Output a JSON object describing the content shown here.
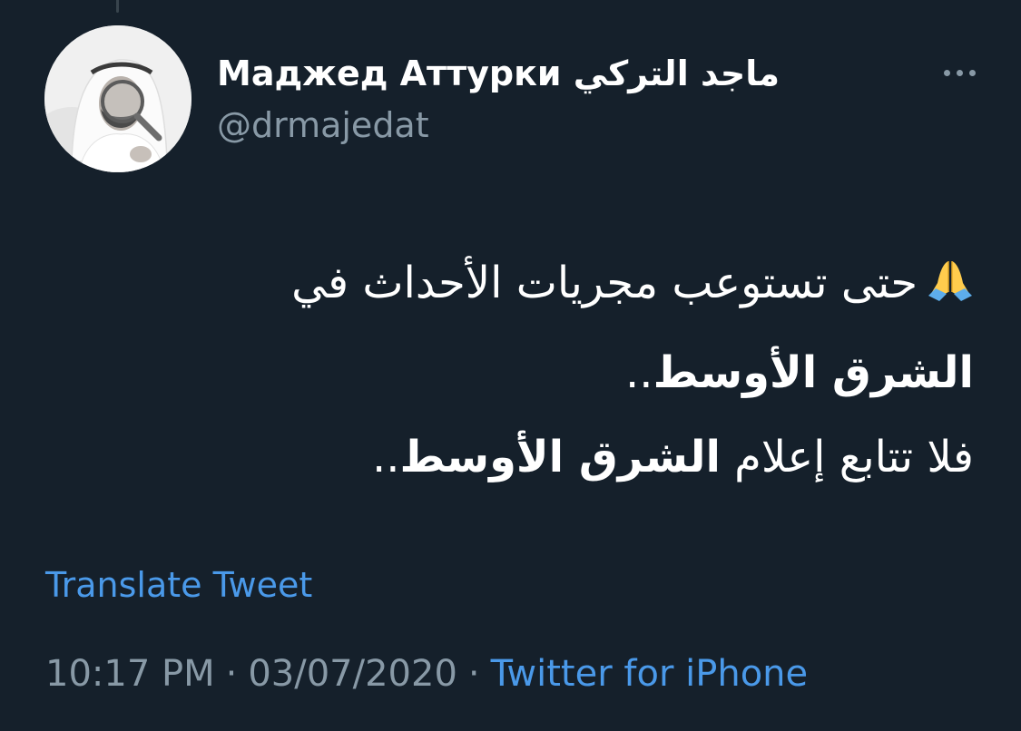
{
  "author": {
    "display_name": "Маджед Аттурки ماجد التركي",
    "handle": "@drmajedat",
    "avatar_icon": "profile-photo"
  },
  "more_icon": "more-horizontal-icon",
  "tweet": {
    "line1_text": "حتى تستوعب مجريات الأحداث في",
    "line1_emoji": "folded-hands-emoji",
    "line2_bold": "الشرق الأوسط",
    "line2_trail": "..",
    "line3_text": "فلا تتابع إعلام ",
    "line3_bold": "الشرق الأوسط",
    "line3_trail": ".."
  },
  "translate_label": "Translate Tweet",
  "meta": {
    "time": "10:17 PM",
    "separator": "·",
    "date": "03/07/2020",
    "source": "Twitter for iPhone"
  },
  "colors": {
    "background": "#15202b",
    "link": "#4a99e9",
    "secondary_text": "#8899a6"
  }
}
